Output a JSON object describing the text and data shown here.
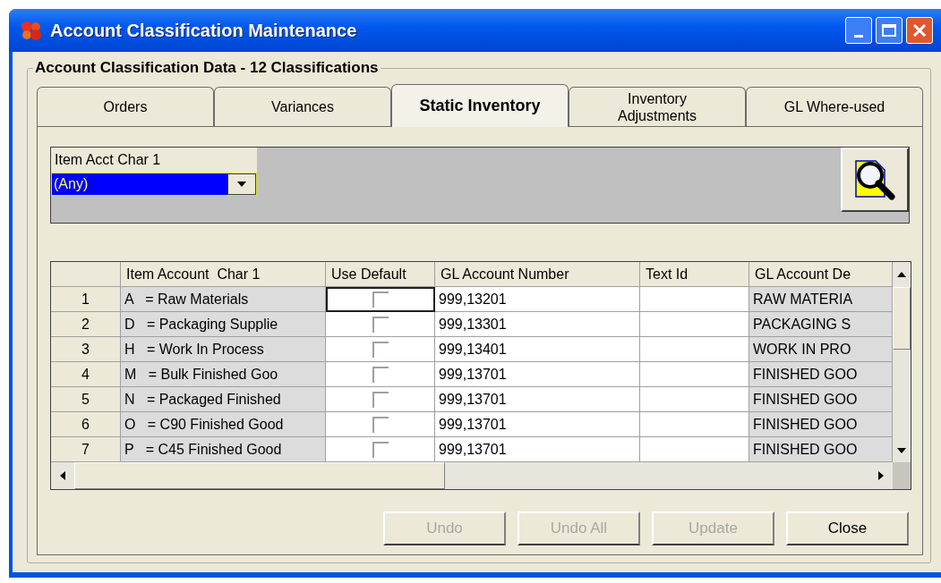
{
  "window": {
    "title": "Account Classification Maintenance"
  },
  "group": {
    "title": "Account Classification Data - 12 Classifications"
  },
  "tabs": [
    {
      "lines": [
        "Orders"
      ],
      "selected": false
    },
    {
      "lines": [
        "Variances"
      ],
      "selected": false
    },
    {
      "lines": [
        "Static Inventory"
      ],
      "selected": true
    },
    {
      "lines": [
        "Inventory",
        "Adjustments"
      ],
      "selected": false
    },
    {
      "lines": [
        "GL Where-used"
      ],
      "selected": false
    }
  ],
  "filter": {
    "label": "Item Acct Char 1",
    "value": "(Any)"
  },
  "table": {
    "columns": [
      {
        "label": "Item Account  Char 1",
        "readonly": true,
        "kind": "text"
      },
      {
        "label": "Use Default",
        "readonly": false,
        "kind": "checkbox"
      },
      {
        "label": "GL Account Number",
        "readonly": false,
        "kind": "text"
      },
      {
        "label": "Text Id",
        "readonly": false,
        "kind": "text"
      },
      {
        "label": "GL Account De",
        "readonly": true,
        "kind": "text"
      }
    ],
    "rows": [
      {
        "number": "1",
        "focused": true,
        "cells": [
          "A   = Raw Materials",
          false,
          "999,13201",
          "",
          "RAW MATERIA"
        ]
      },
      {
        "number": "2",
        "focused": false,
        "cells": [
          "D   = Packaging Supplie",
          false,
          "999,13301",
          "",
          "PACKAGING S"
        ]
      },
      {
        "number": "3",
        "focused": false,
        "cells": [
          "H   = Work In Process",
          false,
          "999,13401",
          "",
          "WORK IN PRO"
        ]
      },
      {
        "number": "4",
        "focused": false,
        "cells": [
          "M   = Bulk Finished Goo",
          false,
          "999,13701",
          "",
          "FINISHED GOO"
        ]
      },
      {
        "number": "5",
        "focused": false,
        "cells": [
          "N   = Packaged Finished",
          false,
          "999,13701",
          "",
          "FINISHED GOO"
        ]
      },
      {
        "number": "6",
        "focused": false,
        "cells": [
          "O   = C90 Finished Good",
          false,
          "999,13701",
          "",
          "FINISHED GOO"
        ]
      },
      {
        "number": "7",
        "focused": false,
        "cells": [
          "P   = C45 Finished Good",
          false,
          "999,13701",
          "",
          "FINISHED GOO"
        ]
      }
    ]
  },
  "buttons": [
    {
      "label": "Undo",
      "disabled": true
    },
    {
      "label": "Undo All",
      "disabled": true
    },
    {
      "label": "Update",
      "disabled": true
    },
    {
      "label": "Close",
      "disabled": false
    }
  ]
}
